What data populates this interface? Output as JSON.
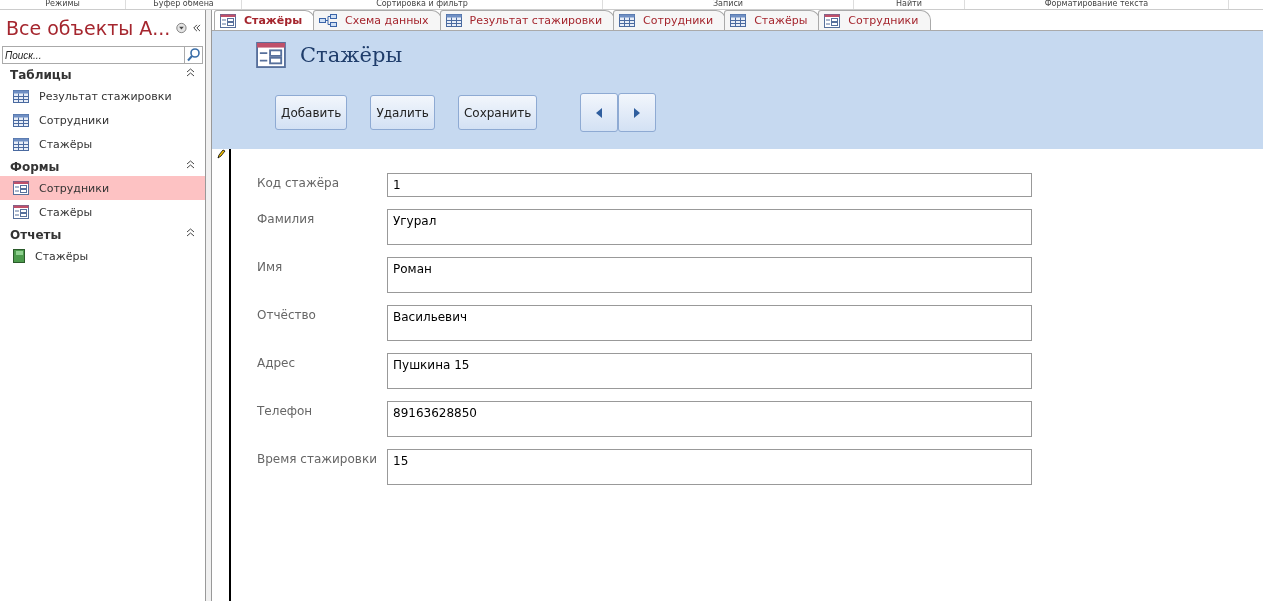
{
  "ribbon_groups": [
    "Режимы",
    "Буфер обмена",
    "Сортировка и фильтр",
    "Записи",
    "Найти",
    "Форматирование текста"
  ],
  "navigation": {
    "title": "Все объекты А...",
    "search": {
      "placeholder": "Поиск..."
    },
    "groups": [
      {
        "label": "Таблицы",
        "expanded": true,
        "items": [
          {
            "label": "Результат стажировки",
            "kind": "table",
            "selected": false
          },
          {
            "label": "Сотрудники",
            "kind": "table",
            "selected": false
          },
          {
            "label": "Стажёры",
            "kind": "table",
            "selected": false
          }
        ]
      },
      {
        "label": "Формы",
        "expanded": true,
        "items": [
          {
            "label": "Сотрудники",
            "kind": "form",
            "selected": true
          },
          {
            "label": "Стажёры",
            "kind": "form",
            "selected": false
          }
        ]
      },
      {
        "label": "Отчеты",
        "expanded": true,
        "items": [
          {
            "label": "Стажёры",
            "kind": "report",
            "selected": false
          }
        ]
      }
    ]
  },
  "tabs": [
    {
      "label": "Стажёры",
      "kind": "form",
      "selected": true
    },
    {
      "label": "Схема данных",
      "kind": "relations",
      "selected": false
    },
    {
      "label": "Результат стажировки",
      "kind": "table",
      "selected": false
    },
    {
      "label": "Сотрудники",
      "kind": "table",
      "selected": false
    },
    {
      "label": "Стажёры",
      "kind": "table",
      "selected": false
    },
    {
      "label": "Сотрудники",
      "kind": "form",
      "selected": false
    }
  ],
  "form": {
    "title": "Стажёры",
    "buttons": [
      "Добавить",
      "Удалить",
      "Сохранить"
    ],
    "fields": [
      {
        "label": "Код стажёра",
        "value": "1"
      },
      {
        "label": "Фамилия",
        "value": "Угурал"
      },
      {
        "label": "Имя",
        "value": "Роман"
      },
      {
        "label": "Отчёство",
        "value": "Васильевич"
      },
      {
        "label": "Адрес",
        "value": "Пушкина 15"
      },
      {
        "label": "Телефон",
        "value": "89163628850"
      },
      {
        "label": "Время стажировки",
        "value": "15"
      }
    ]
  }
}
